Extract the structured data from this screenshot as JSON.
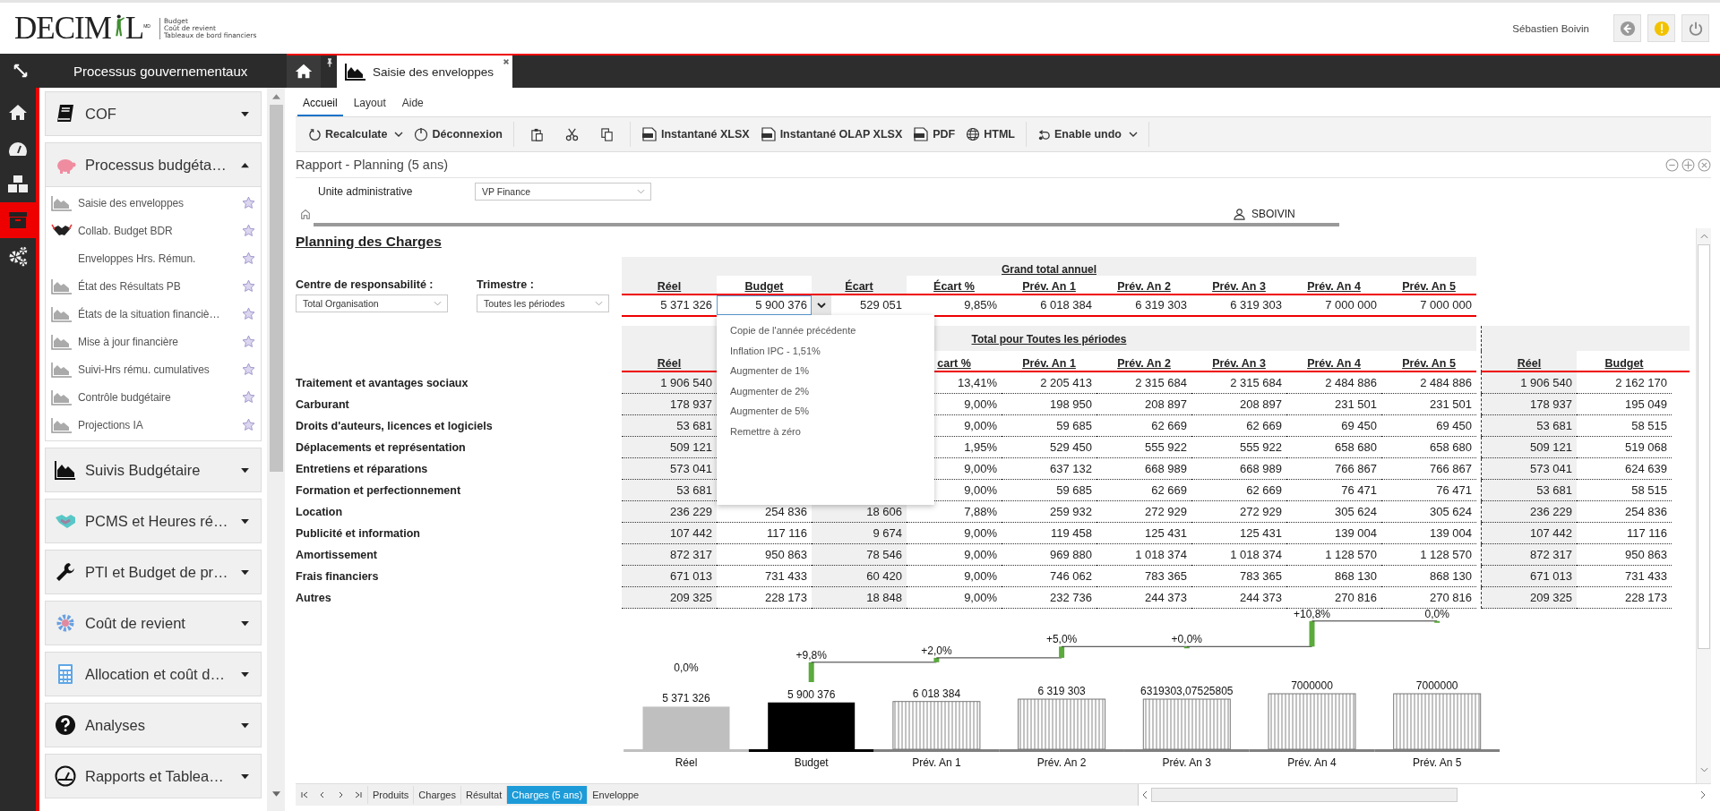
{
  "header": {
    "logo": {
      "left": "DECIM",
      "right": "L",
      "mark": "MD",
      "tagline": [
        "Budget",
        "Coût de revient",
        "Tableaux de bord financiers"
      ]
    },
    "user": "Sébastien Boivin"
  },
  "rail": [
    {
      "selected": false
    },
    {
      "selected": false
    },
    {
      "selected": false
    },
    {
      "selected": true
    },
    {
      "selected": false
    }
  ],
  "sidebar": {
    "title": "Processus gouvernementaux",
    "groups": [
      {
        "label": "COF",
        "expanded": false
      },
      {
        "label": "Processus budgéta…",
        "expanded": true,
        "items": [
          {
            "label": "Saisie des enveloppes",
            "kind": "report"
          },
          {
            "label": "Collab. Budget BDR",
            "kind": "collab"
          },
          {
            "label": "Enveloppes Hrs. Rémun.",
            "kind": "plain"
          },
          {
            "label": "État des Résultats PB",
            "kind": "report"
          },
          {
            "label": "États de la situation financiè…",
            "kind": "report"
          },
          {
            "label": "Mise à jour financière",
            "kind": "report"
          },
          {
            "label": "Suivi-Hrs rému. cumulatives",
            "kind": "report"
          },
          {
            "label": "Contrôle budgétaire",
            "kind": "report"
          },
          {
            "label": "Projections IA",
            "kind": "report"
          }
        ]
      },
      {
        "label": "Suivis Budgétaire",
        "expanded": false
      },
      {
        "label": "PCMS et Heures ré…",
        "expanded": false
      },
      {
        "label": "PTI et Budget de pr…",
        "expanded": false
      },
      {
        "label": "Coût de revient",
        "expanded": false
      },
      {
        "label": "Allocation et coût d…",
        "expanded": false
      },
      {
        "label": "Analyses",
        "expanded": false
      },
      {
        "label": "Rapports et Tablea…",
        "expanded": false
      }
    ]
  },
  "tabs": {
    "home_selected": false,
    "items": [
      {
        "label": "Saisie des enveloppes",
        "selected": true
      }
    ]
  },
  "ribbon": [
    {
      "label": "Accueil",
      "selected": true
    },
    {
      "label": "Layout",
      "selected": false
    },
    {
      "label": "Aide",
      "selected": false
    }
  ],
  "toolbar": {
    "recalculate": "Recalculate",
    "logout": "Déconnexion",
    "xlsx": "Instantané XLSX",
    "olap": "Instantané OLAP XLSX",
    "pdf": "PDF",
    "html": "HTML",
    "undo": "Enable undo"
  },
  "report": {
    "title": "Rapport - Planning (5 ans)",
    "unit_label": "Unite administrative",
    "unit_value": "VP Finance",
    "user": "SBOIVIN"
  },
  "sheet": {
    "title": "Planning des Charges",
    "filters": [
      {
        "label": "Centre de responsabilité :",
        "value": "Total Organisation"
      },
      {
        "label": "Trimestre :",
        "value": "Toutes les périodes"
      }
    ],
    "grand_total": {
      "title": "Grand total annuel",
      "columns": [
        "Réel",
        "Budget",
        "Écart",
        "Écart %",
        "Prév. An 1",
        "Prév. An 2",
        "Prév. An 3",
        "Prév. An 4",
        "Prév. An 5"
      ],
      "cells": [
        {
          "value": "5 371 326",
          "editing": false
        },
        {
          "value": "5 900 376",
          "editing": true
        },
        {
          "value": "529 051",
          "editing": false
        },
        {
          "value": "9,85%",
          "editing": false
        },
        {
          "value": "6 018 384",
          "editing": false
        },
        {
          "value": "6 319 303",
          "editing": false
        },
        {
          "value": "6 319 303",
          "editing": false
        },
        {
          "value": "7 000 000",
          "editing": false
        },
        {
          "value": "7 000 000",
          "editing": false
        }
      ]
    },
    "cell_menu": {
      "items": [
        "Copie de l'année précédente",
        "Inflation IPC - 1,51%",
        "Augmenter de 1%",
        "Augmenter de 2%",
        "Augmenter de 5%",
        "Remettre à zéro"
      ]
    },
    "periods": {
      "title": "Total pour Toutes les périodes",
      "columns": [
        "Réel",
        null,
        null,
        "cart %",
        "Prév. An 1",
        "Prév. An 2",
        "Prév. An 3",
        "Prév. An 4",
        "Prév. An 5"
      ],
      "side_columns": [
        "Réel",
        "Budget"
      ],
      "rows": [
        {
          "label": "Traitement et avantages sociaux",
          "cells": [
            "1 906 540",
            null,
            null,
            "13,41%",
            "2 205 413",
            "2 315 684",
            "2 315 684",
            "2 484 886",
            "2 484 886"
          ],
          "side": [
            "1 906 540",
            "2 162 170"
          ]
        },
        {
          "label": "Carburant",
          "cells": [
            "178 937",
            null,
            null,
            "9,00%",
            "198 950",
            "208 897",
            "208 897",
            "231 501",
            "231 501"
          ],
          "side": [
            "178 937",
            "195 049"
          ]
        },
        {
          "label": "Droits d'auteurs, licences et logiciels",
          "cells": [
            "53 681",
            null,
            null,
            "9,00%",
            "59 685",
            "62 669",
            "62 669",
            "69 450",
            "69 450"
          ],
          "side": [
            "53 681",
            "58 515"
          ]
        },
        {
          "label": "Déplacements et représentation",
          "cells": [
            "509 121",
            null,
            null,
            "1,95%",
            "529 450",
            "555 922",
            "555 922",
            "658 680",
            "658 680"
          ],
          "side": [
            "509 121",
            "519 068"
          ]
        },
        {
          "label": "Entretiens et réparations",
          "cells": [
            "573 041",
            null,
            null,
            "9,00%",
            "637 132",
            "668 989",
            "668 989",
            "766 867",
            "766 867"
          ],
          "side": [
            "573 041",
            "624 639"
          ]
        },
        {
          "label": "Formation et perfectionnement",
          "cells": [
            "53 681",
            null,
            null,
            "9,00%",
            "59 685",
            "62 669",
            "62 669",
            "76 471",
            "76 471"
          ],
          "side": [
            "53 681",
            "58 515"
          ]
        },
        {
          "label": "Location",
          "cells": [
            "236 229",
            "254 836",
            "18 606",
            "7,88%",
            "259 932",
            "272 929",
            "272 929",
            "305 624",
            "305 624"
          ],
          "side": [
            "236 229",
            "254 836"
          ]
        },
        {
          "label": "Publicité et information",
          "cells": [
            "107 442",
            "117 116",
            "9 674",
            "9,00%",
            "119 458",
            "125 431",
            "125 431",
            "139 004",
            "139 004"
          ],
          "side": [
            "107 442",
            "117 116"
          ]
        },
        {
          "label": "Amortissement",
          "cells": [
            "872 317",
            "950 863",
            "78 546",
            "9,00%",
            "969 880",
            "1 018 374",
            "1 018 374",
            "1 128 570",
            "1 128 570"
          ],
          "side": [
            "872 317",
            "950 863"
          ]
        },
        {
          "label": "Frais financiers",
          "cells": [
            "671 013",
            "731 433",
            "60 420",
            "9,00%",
            "746 062",
            "783 365",
            "783 365",
            "868 130",
            "868 130"
          ],
          "side": [
            "671 013",
            "731 433"
          ]
        },
        {
          "label": "Autres",
          "cells": [
            "209 325",
            "228 173",
            "18 848",
            "9,00%",
            "232 736",
            "244 373",
            "244 373",
            "270 816",
            "270 816"
          ],
          "side": [
            "209 325",
            "228 173"
          ]
        }
      ]
    },
    "chart_data": {
      "type": "bar",
      "categories": [
        "Réel",
        "Budget",
        "Prév. An 1",
        "Prév. An 2",
        "Prév. An 3",
        "Prév. An 4",
        "Prév. An 5"
      ],
      "values": [
        5371326,
        5900376,
        6018384,
        6319303,
        6319303.07525805,
        7000000,
        7000000
      ],
      "value_labels": [
        "5 371 326",
        "5 900 376",
        "6 018 384",
        "6 319 303",
        "6319303,07525805",
        "7000000",
        "7000000"
      ],
      "annotations": [
        "0,0%",
        "+9,8%",
        "+2,0%",
        "+5,0%",
        "+0,0%",
        "+10,8%",
        "0,0%"
      ]
    },
    "sheet_tabs": [
      {
        "label": "Produits",
        "selected": false
      },
      {
        "label": "Charges",
        "selected": false
      },
      {
        "label": "Résultat",
        "selected": false
      },
      {
        "label": "Charges (5 ans)",
        "selected": true
      },
      {
        "label": "Enveloppe",
        "selected": false
      }
    ]
  }
}
